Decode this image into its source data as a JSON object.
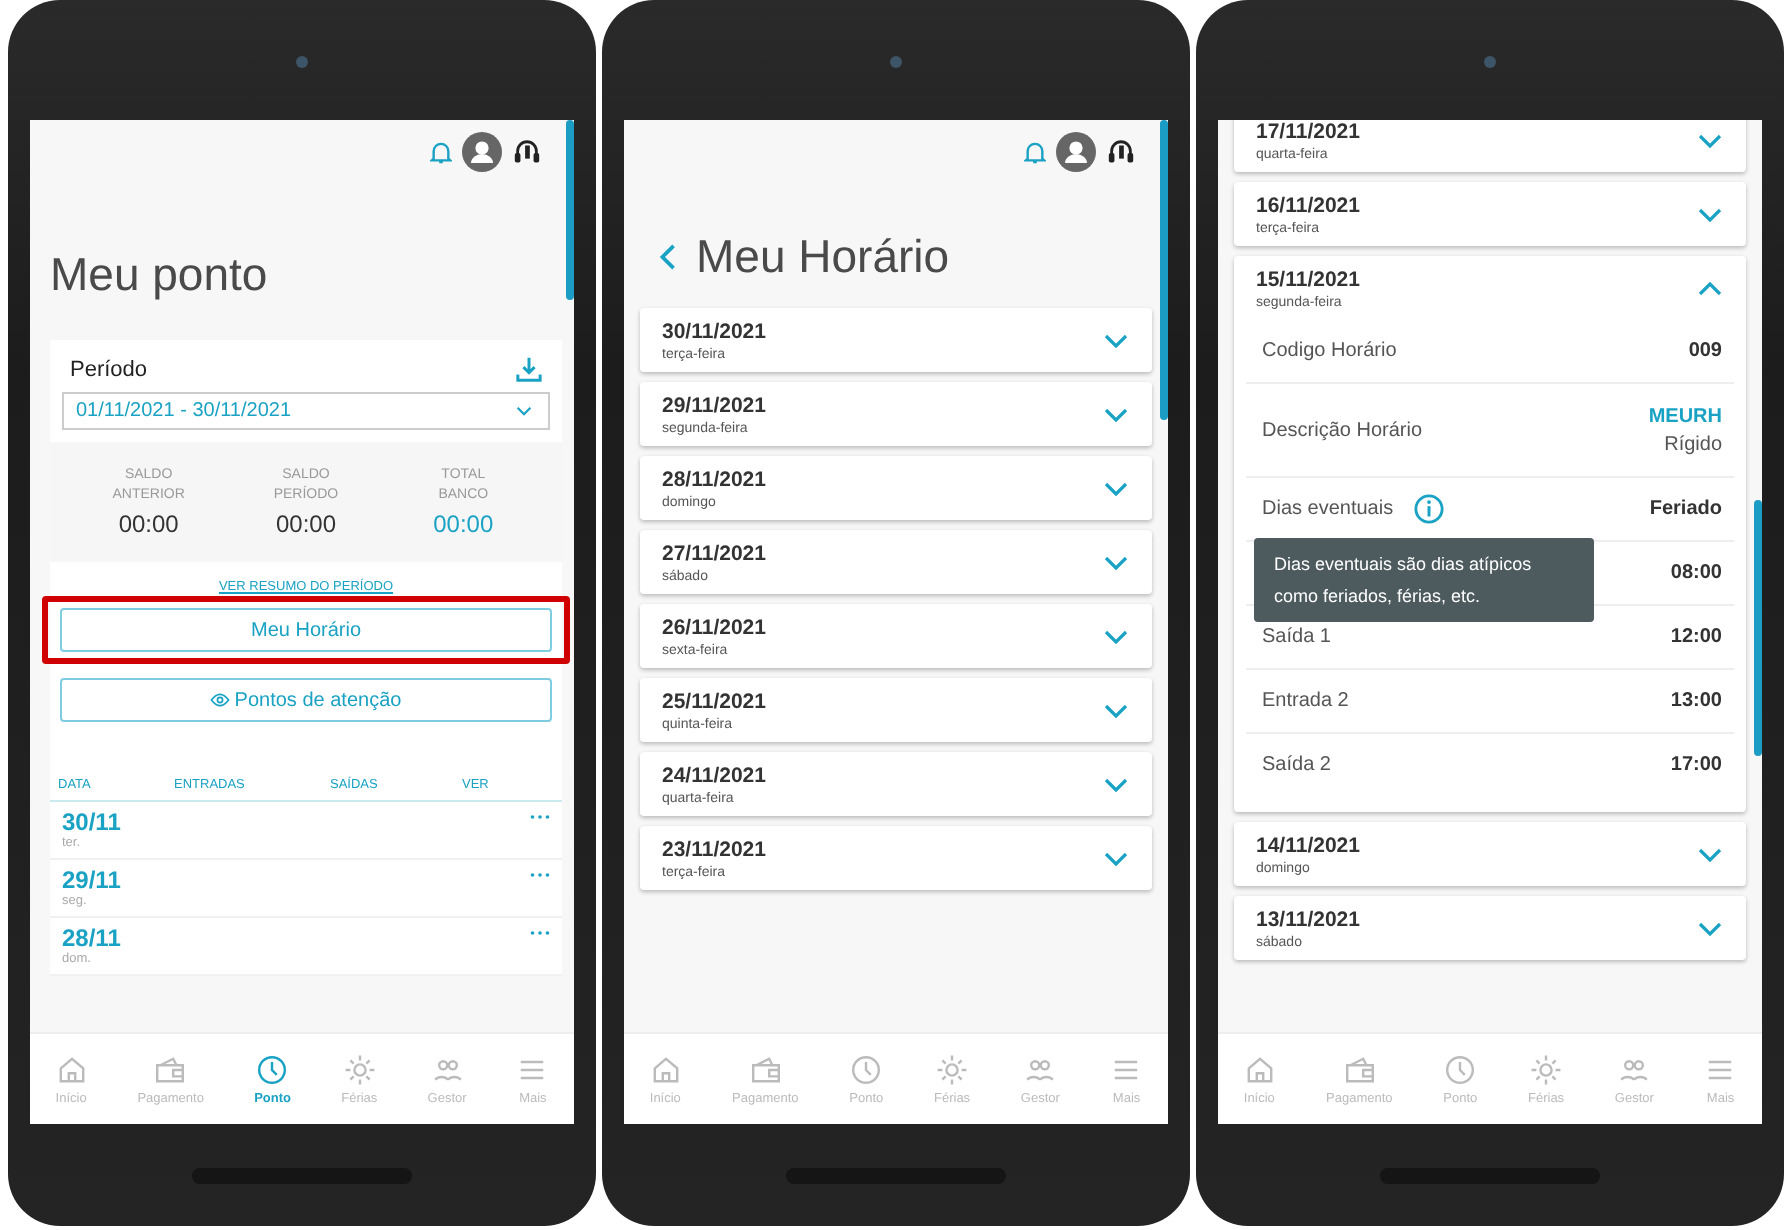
{
  "screen_ponto": {
    "title": "Meu ponto",
    "period": {
      "label": "Período",
      "value": "01/11/2021 - 30/11/2021"
    },
    "balances": [
      {
        "label": "SALDO ANTERIOR",
        "value": "00:00",
        "highlight": false
      },
      {
        "label": "SALDO PERÍODO",
        "value": "00:00",
        "highlight": false
      },
      {
        "label": "TOTAL BANCO",
        "value": "00:00",
        "highlight": true
      }
    ],
    "summary_link": "VER RESUMO DO PERÍODO",
    "buttons": [
      {
        "label": "Meu Horário",
        "highlighted": true,
        "kind": "plain"
      },
      {
        "label": "Pontos de atenção",
        "highlighted": false,
        "kind": "eye"
      }
    ],
    "table": {
      "columns": [
        "DATA",
        "ENTRADAS",
        "SAÍDAS",
        "VER"
      ],
      "rows": [
        {
          "date": "30/11",
          "weekday": "ter."
        },
        {
          "date": "29/11",
          "weekday": "seg."
        },
        {
          "date": "28/11",
          "weekday": "dom."
        }
      ]
    },
    "bottom_nav": [
      {
        "label": "Início",
        "selected": false
      },
      {
        "label": "Pagamento",
        "selected": false
      },
      {
        "label": "Ponto",
        "selected": true
      },
      {
        "label": "Férias",
        "selected": false
      },
      {
        "label": "Gestor",
        "selected": false
      },
      {
        "label": "Mais",
        "selected": false
      }
    ]
  },
  "screen_horario": {
    "title": "Meu Horário",
    "days": [
      {
        "date": "30/11/2021",
        "weekday": "terça-feira",
        "expanded": false
      },
      {
        "date": "29/11/2021",
        "weekday": "segunda-feira",
        "expanded": false
      },
      {
        "date": "28/11/2021",
        "weekday": "domingo",
        "expanded": false
      },
      {
        "date": "27/11/2021",
        "weekday": "sábado",
        "expanded": false
      },
      {
        "date": "26/11/2021",
        "weekday": "sexta-feira",
        "expanded": false
      },
      {
        "date": "25/11/2021",
        "weekday": "quinta-feira",
        "expanded": false
      },
      {
        "date": "24/11/2021",
        "weekday": "quarta-feira",
        "expanded": false
      },
      {
        "date": "23/11/2021",
        "weekday": "terça-feira",
        "expanded": false
      }
    ],
    "bottom_nav": [
      {
        "label": "Início",
        "selected": false
      },
      {
        "label": "Pagamento",
        "selected": false
      },
      {
        "label": "Ponto",
        "selected": false
      },
      {
        "label": "Férias",
        "selected": false
      },
      {
        "label": "Gestor",
        "selected": false
      },
      {
        "label": "Mais",
        "selected": false
      }
    ]
  },
  "screen_detalhe": {
    "days": [
      {
        "date": "17/11/2021",
        "weekday": "quarta-feira",
        "expanded": false
      },
      {
        "date": "16/11/2021",
        "weekday": "terça-feira",
        "expanded": false
      },
      {
        "date": "15/11/2021",
        "weekday": "segunda-feira",
        "expanded": true,
        "details": [
          {
            "label": "Codigo Horário",
            "value": "009"
          },
          {
            "label": "Descrição Horário",
            "value": "MEURH",
            "sub": "Rígido"
          },
          {
            "label": "Dias eventuais",
            "value": "Feriado",
            "info": true
          },
          {
            "value": "08:00"
          },
          {
            "label": "Saída 1",
            "value": "12:00"
          },
          {
            "label": "Entrada 2",
            "value": "13:00"
          },
          {
            "label": "Saída 2",
            "value": "17:00"
          }
        ]
      },
      {
        "date": "14/11/2021",
        "weekday": "domingo",
        "expanded": false
      },
      {
        "date": "13/11/2021",
        "weekday": "sábado",
        "expanded": false
      }
    ],
    "tooltip": "Dias eventuais são dias atípicos como feriados, férias, etc.",
    "bottom_nav": [
      {
        "label": "Início",
        "selected": false
      },
      {
        "label": "Pagamento",
        "selected": false
      },
      {
        "label": "Ponto",
        "selected": false
      },
      {
        "label": "Férias",
        "selected": false
      },
      {
        "label": "Gestor",
        "selected": false
      },
      {
        "label": "Mais",
        "selected": false
      }
    ]
  }
}
